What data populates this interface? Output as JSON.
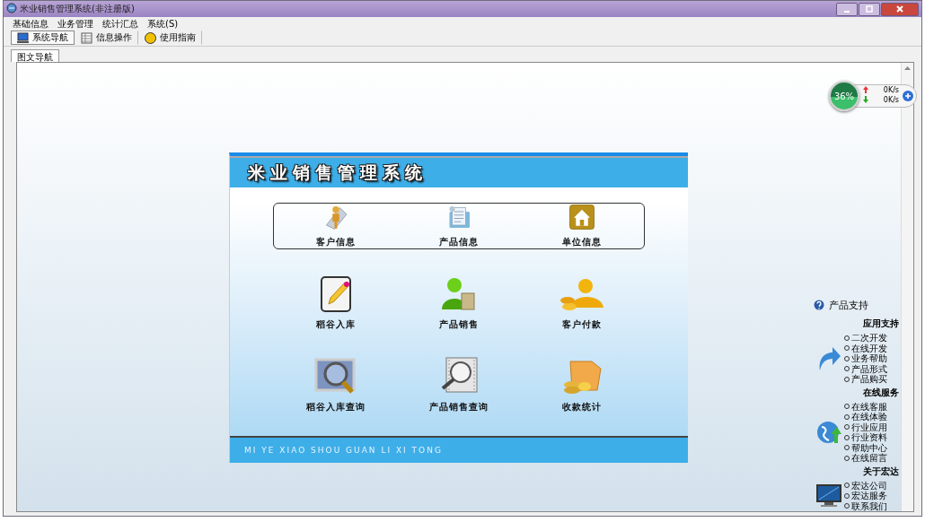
{
  "window": {
    "title": "米业销售管理系统(非注册版)"
  },
  "menu": [
    "基础信息",
    "业务管理",
    "统计汇总",
    "系统(S)"
  ],
  "toolbar": [
    {
      "label": "系统导航",
      "selected": true
    },
    {
      "label": "信息操作",
      "selected": false
    },
    {
      "label": "使用指南",
      "selected": false
    }
  ],
  "tabs": [
    {
      "label": "图文导航",
      "selected": true
    }
  ],
  "net_monitor": {
    "percent": "36%",
    "upload": "0K/s",
    "download": "0K/s"
  },
  "panel": {
    "title": "米业销售管理系统",
    "footer": "MI YE XIAO SHOU GUAN LI XI TONG",
    "rows": [
      {
        "boxed": true,
        "modules": [
          "客户信息",
          "产品信息",
          "单位信息"
        ]
      },
      {
        "boxed": false,
        "modules": [
          "稻谷入库",
          "产品销售",
          "客户付款"
        ]
      },
      {
        "boxed": false,
        "modules": [
          "稻谷入库查询",
          "产品销售查询",
          "收款统计"
        ]
      }
    ]
  },
  "support": {
    "title": "产品支持",
    "groups": [
      {
        "heading": "应用支持",
        "items": [
          "二次开发",
          "在线开发",
          "业务帮助",
          "产品形式",
          "产品购买"
        ]
      },
      {
        "heading": "在线服务",
        "items": [
          "在线客服",
          "在线体验",
          "行业应用",
          "行业资料",
          "帮助中心",
          "在线留言"
        ]
      },
      {
        "heading": "关于宏达",
        "items": [
          "宏达公司",
          "宏达服务",
          "联系我们"
        ]
      }
    ]
  }
}
